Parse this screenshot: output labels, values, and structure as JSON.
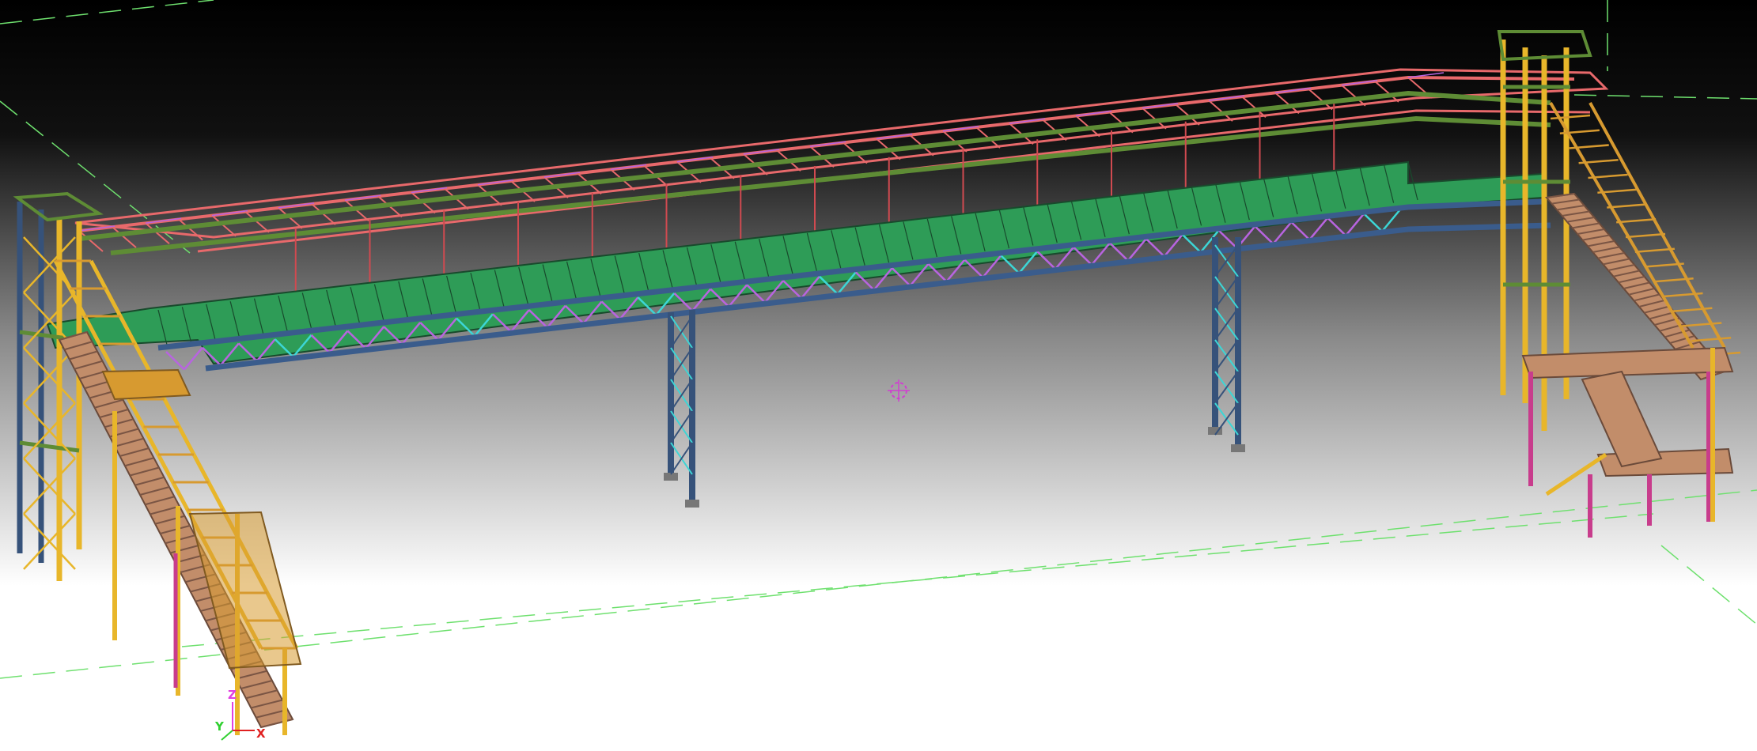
{
  "viewport": {
    "background_top": "#000000",
    "background_mid": "#8a8a8a",
    "background_bottom": "#ffffff"
  },
  "colors": {
    "deck": "#2e9c57",
    "deck_edge": "#184a2c",
    "roof_truss": "#e8696b",
    "hanger": "#d04a50",
    "stringer": "#3a5c8c",
    "column": "#36527a",
    "green_beam": "#5e8c35",
    "bracing_purple": "#b864e0",
    "bracing_cyan": "#3cd6d6",
    "stair_yellow": "#e8b62a",
    "stair_tread": "#c28d6a",
    "stair_rail": "#d79a30",
    "post_magenta": "#c83c8c",
    "grid_line": "#6ee06e"
  },
  "icons": {
    "rotation_center": "pivot-target-icon",
    "view_axes": "axis-triad-icon"
  },
  "axes": {
    "x_label": "X",
    "y_label": "Y",
    "z_label": "Z"
  }
}
